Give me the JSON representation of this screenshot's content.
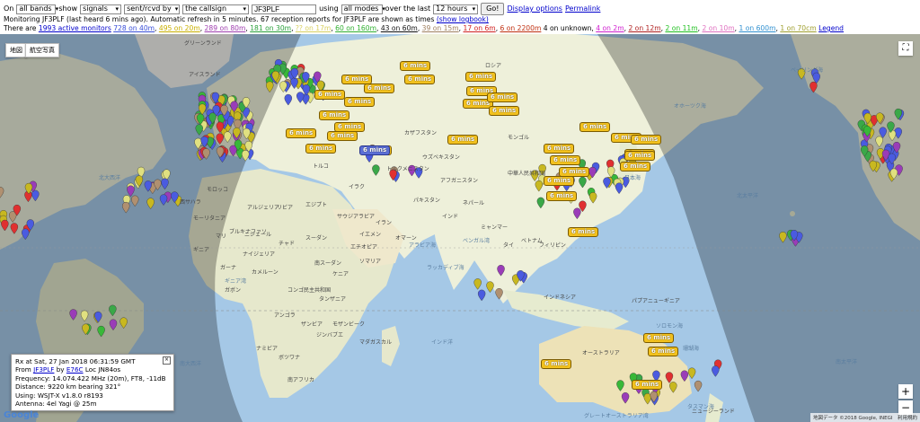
{
  "controls": {
    "on_label": "On",
    "bands_value": "all bands",
    "show_label": "show",
    "show_value": "signals",
    "direction_value": "sent/rcvd by",
    "target_value": "the callsign",
    "callsign_value": "JF3PLF",
    "using_label": "using",
    "modes_value": "all modes",
    "over_label": "over the last",
    "period_value": "12 hours",
    "go_label": "Go!",
    "display_options": "Display options",
    "permalink": "Permalink"
  },
  "status": {
    "monitoring": "Monitoring JF3PLF (last heard 6 mins ago). Automatic refresh in 5 minutes. 67 reception reports for JF3PLF are shown as times",
    "show_logbook": "(show logbook)"
  },
  "monitors": {
    "prefix": "There are",
    "active": "1993 active monitors",
    "bands": [
      {
        "text": "728 on 40m",
        "color": "#3a4fd8"
      },
      {
        "text": "495 on 20m",
        "color": "#c9b000"
      },
      {
        "text": "289 on 80m",
        "color": "#a040b0"
      },
      {
        "text": "181 on 30m",
        "color": "#2aa03a"
      },
      {
        "text": "?? on 17m",
        "color": "#d8d060"
      },
      {
        "text": "60 on 160m",
        "color": "#30b030"
      },
      {
        "text": "43 on 60m",
        "color": "#111111"
      },
      {
        "text": "39 on 15m",
        "color": "#a08060"
      },
      {
        "text": "17 on 6m",
        "color": "#d02020"
      },
      {
        "text": "6 on 2200m",
        "color": "#c03010"
      }
    ],
    "unknown": "4 on unknown,",
    "bands2": [
      {
        "text": "4 on 2m",
        "color": "#d020d0"
      },
      {
        "text": "2 on 12m",
        "color": "#b02020"
      },
      {
        "text": "2 on 11m",
        "color": "#20c020"
      },
      {
        "text": "2 on 10m",
        "color": "#e070c0"
      },
      {
        "text": "1 on 600m",
        "color": "#3090d0"
      },
      {
        "text": "1 on 70cm",
        "color": "#a0a030"
      }
    ],
    "legend": "Legend"
  },
  "map": {
    "type_map": "地図",
    "type_satellite": "航空写真",
    "spot_label": "6 mins",
    "copyright": "地図データ ©2018 Google, INEGI　利用規約",
    "google": "Google"
  },
  "info": {
    "rx": "Rx at Sat, 27 Jan 2018 06:31:59 GMT",
    "from_prefix": "From",
    "from_call": "JF3PLF",
    "by_label": "by",
    "by_call": "E76C",
    "loc": "Loc JN84os",
    "frequency": "Frequency: 14.074.422 MHz (20m), FT8, -11dB",
    "distance": "Distance: 9220 km bearing 321°",
    "using": "Using: WSJT-X v1.8.0 r8193",
    "antenna": "Antenna: 4el Yagi @ 25m"
  },
  "place_labels": [
    "ロシア",
    "カザフスタン",
    "モンゴル",
    "中華人民共和国",
    "インド",
    "イラン",
    "サウジアラビア",
    "エジプト",
    "リビア",
    "アルジェリア",
    "マリ",
    "ニジェール",
    "チャド",
    "スーダン",
    "ナイジェリア",
    "コンゴ民主共和国",
    "タンザニア",
    "アンゴラ",
    "ナミビア",
    "南アフリカ",
    "マダガスカル",
    "オーストラリア",
    "インドネシア",
    "パプアニューギニア",
    "フィリピン",
    "タイ",
    "パキスタン",
    "トルクメニスタン",
    "ウズベキスタン",
    "エチオピア",
    "ケニア",
    "ソマリア",
    "イエメン",
    "オマーン",
    "ミャンマー",
    "ベトナム",
    "ニュージーランド",
    "グリーンランド",
    "アイスランド",
    "モロッコ",
    "イラク",
    "トルコ",
    "アフガニスタン",
    "ネパール",
    "ボツワナ",
    "ザンビア",
    "モザンビーク",
    "ジンバブエ",
    "ガボン",
    "カメルーン",
    "ブルキナファソ",
    "モーリタニア",
    "西サハラ",
    "ギニア",
    "ガーナ",
    "南スーダン"
  ],
  "ocean_labels": [
    "北大西洋",
    "インド洋",
    "南大西洋",
    "北太平洋",
    "南太平洋",
    "アラビア海",
    "ベンガル湾",
    "タスマン海",
    "ラッカディブ海",
    "オホーツク海",
    "ベーリング海",
    "グレートオーストラリア湾",
    "ギニア湾",
    "ソロモン海",
    "珊瑚海",
    "日本海"
  ]
}
